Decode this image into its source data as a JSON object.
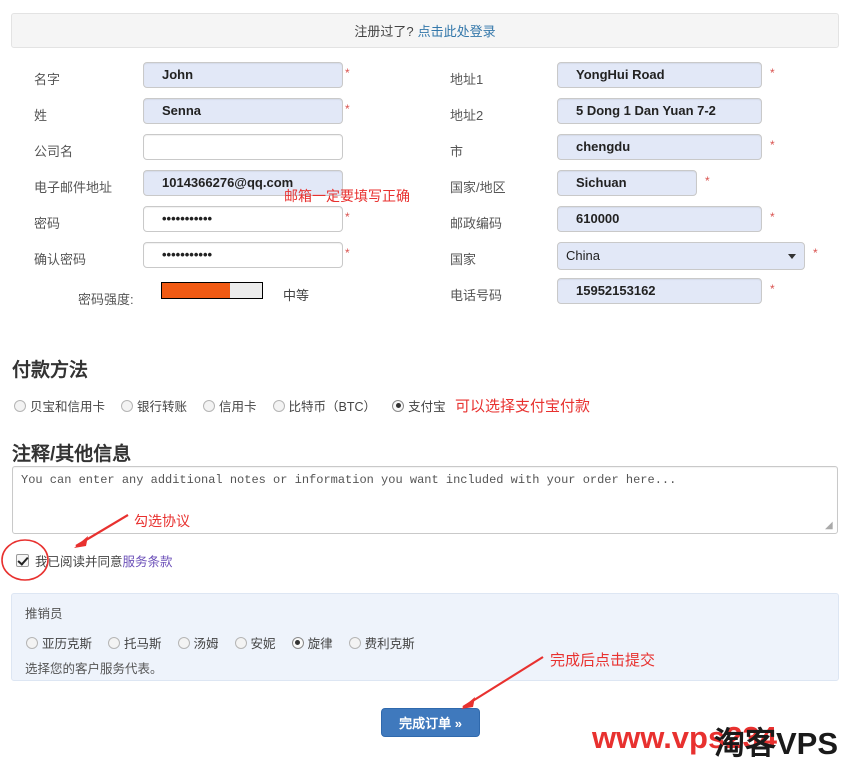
{
  "login_bar": {
    "text": "注册过了?",
    "link": "点击此处登录"
  },
  "form": {
    "left": [
      {
        "label": "名字",
        "value": "John",
        "placeholder": "",
        "required": true,
        "filled": true,
        "width": "w200"
      },
      {
        "label": "姓",
        "value": "Senna",
        "placeholder": "",
        "required": true,
        "filled": true,
        "width": "w200"
      },
      {
        "label": "公司名",
        "value": "",
        "placeholder": "",
        "required": false,
        "filled": false,
        "width": "w200"
      },
      {
        "label": "电子邮件地址",
        "value": "1014366276@qq.com",
        "placeholder": "",
        "required": false,
        "filled": true,
        "width": "w200"
      },
      {
        "label": "密码",
        "value": "•••••••••••",
        "placeholder": "",
        "required": true,
        "filled": false,
        "width": "w200"
      },
      {
        "label": "确认密码",
        "value": "•••••••••••",
        "placeholder": "",
        "required": true,
        "filled": false,
        "width": "w200"
      }
    ],
    "right": [
      {
        "label": "地址1",
        "value": "YongHui Road",
        "required": true,
        "filled": true,
        "width": "w205",
        "type": "input"
      },
      {
        "label": "地址2",
        "value": "5 Dong 1 Dan Yuan 7-2",
        "required": false,
        "filled": true,
        "width": "w205",
        "type": "input"
      },
      {
        "label": "市",
        "value": "chengdu",
        "required": true,
        "filled": true,
        "width": "w205",
        "type": "input"
      },
      {
        "label": "国家/地区",
        "value": "Sichuan",
        "required": true,
        "filled": true,
        "width": "w140",
        "type": "input"
      },
      {
        "label": "邮政编码",
        "value": "610000",
        "required": true,
        "filled": true,
        "width": "w205",
        "type": "input"
      },
      {
        "label": "国家",
        "value": "China",
        "required": true,
        "filled": true,
        "width": "w248",
        "type": "select"
      },
      {
        "label": "电话号码",
        "value": "15952153162",
        "required": true,
        "filled": true,
        "width": "w205",
        "type": "input"
      }
    ],
    "required_marker": "*"
  },
  "password_strength": {
    "label": "密码强度:",
    "percent": 68,
    "status": "中等",
    "fill_color": "#f15a13"
  },
  "payment": {
    "heading": "付款方法",
    "options": [
      {
        "label": "贝宝和信用卡",
        "selected": false
      },
      {
        "label": "银行转账",
        "selected": false
      },
      {
        "label": "信用卡",
        "selected": false
      },
      {
        "label": "比特币（BTC）",
        "selected": false
      },
      {
        "label": "支付宝",
        "selected": true
      }
    ]
  },
  "notes": {
    "heading": "注释/其他信息",
    "placeholder": "You can enter any additional notes or information you want included with your order here...",
    "value": ""
  },
  "agreement": {
    "checked": true,
    "text": "我已阅读并同意",
    "link": "服务条款"
  },
  "salesperson": {
    "title": "推销员",
    "options": [
      {
        "label": "亚历克斯",
        "selected": false
      },
      {
        "label": "托马斯",
        "selected": false
      },
      {
        "label": "汤姆",
        "selected": false
      },
      {
        "label": "安妮",
        "selected": false
      },
      {
        "label": "旋律",
        "selected": true
      },
      {
        "label": "费利克斯",
        "selected": false
      }
    ],
    "help": "选择您的客户服务代表。"
  },
  "submit": {
    "label": "完成订单 »"
  },
  "annotations": {
    "email": "邮箱一定要填写正确",
    "payment": "可以选择支付宝付款",
    "checkbox": "勾选协议",
    "submit": "完成后点击提交"
  },
  "watermark": {
    "red": "www.vps234",
    "black": "淘客VPS"
  },
  "colors": {
    "accent_blue": "#3f79bd",
    "link_blue": "#3377aa",
    "annotation_red": "#e8312f",
    "filled_field": "#e2e8f7",
    "strength_orange": "#f15a13"
  }
}
